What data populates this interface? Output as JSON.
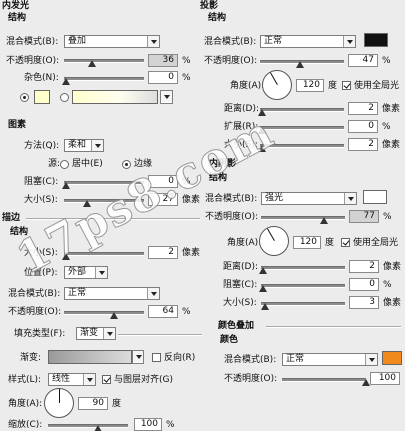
{
  "inner_glow": {
    "title": "内发光",
    "structure": "结构",
    "blend_mode": {
      "label": "混合模式(B):",
      "value": "叠加"
    },
    "opacity": {
      "label": "不透明度(O):",
      "value": "36",
      "unit": "%"
    },
    "noise": {
      "label": "杂色(N):",
      "value": "0",
      "unit": "%"
    },
    "color": "#ffffcc",
    "elements": "图素",
    "technique": {
      "label": "方法(Q):",
      "value": "柔和"
    },
    "source_label": "源:",
    "source_center": "居中(E)",
    "source_edge": "边缘",
    "choke": {
      "label": "阻塞(C):",
      "value": "0",
      "unit": "%"
    },
    "size": {
      "label": "大小(S):",
      "value": "27",
      "unit": "像素"
    }
  },
  "drop_shadow": {
    "title": "投影",
    "structure": "结构",
    "blend_mode": {
      "label": "混合模式(B):",
      "value": "正常"
    },
    "color": "#111111",
    "opacity": {
      "label": "不透明度(O):",
      "value": "47",
      "unit": "%"
    },
    "angle": {
      "label": "角度(A):",
      "value": "120",
      "unit": "度"
    },
    "global_light": "使用全局光",
    "distance": {
      "label": "距离(D):",
      "value": "2",
      "unit": "像素"
    },
    "spread": {
      "label": "扩展(R):",
      "value": "0",
      "unit": "%"
    },
    "size": {
      "label": "大小(S):",
      "value": "2",
      "unit": "像素"
    }
  },
  "stroke": {
    "title": "描边",
    "structure": "结构",
    "size": {
      "label": "大小(S):",
      "value": "2",
      "unit": "像素"
    },
    "position": {
      "label": "位置(P):",
      "value": "外部"
    },
    "blend_mode": {
      "label": "混合模式(B):",
      "value": "正常"
    },
    "opacity": {
      "label": "不透明度(O):",
      "value": "64",
      "unit": "%"
    },
    "fill_type": {
      "label": "填充类型(F):",
      "value": "渐变"
    },
    "gradient_label": "渐变:",
    "reverse": "反向(R)",
    "style": {
      "label": "样式(L):",
      "value": "线性"
    },
    "align": "与图层对齐(G)",
    "angle": {
      "label": "角度(A):",
      "value": "90",
      "unit": "度"
    },
    "scale": {
      "label": "缩放(C):",
      "value": "100",
      "unit": "%"
    }
  },
  "inner_shadow": {
    "title": "内阴影",
    "structure": "结构",
    "blend_mode": {
      "label": "混合模式(B):",
      "value": "强光"
    },
    "color": "#ffffff",
    "opacity": {
      "label": "不透明度(O):",
      "value": "77",
      "unit": "%"
    },
    "angle": {
      "label": "角度(A):",
      "value": "120",
      "unit": "度"
    },
    "global_light": "使用全局光",
    "distance": {
      "label": "距离(D):",
      "value": "2",
      "unit": "像素"
    },
    "choke": {
      "label": "阻塞(C):",
      "value": "0",
      "unit": "%"
    },
    "size": {
      "label": "大小(S):",
      "value": "3",
      "unit": "像素"
    }
  },
  "color_overlay": {
    "title": "颜色叠加",
    "color_label": "颜色",
    "blend_mode": {
      "label": "混合模式(B):",
      "value": "正常"
    },
    "color": "#f08a1c",
    "opacity": {
      "label": "不透明度(O):",
      "value": "100",
      "unit": "%"
    }
  },
  "watermark": "17ps8.com"
}
